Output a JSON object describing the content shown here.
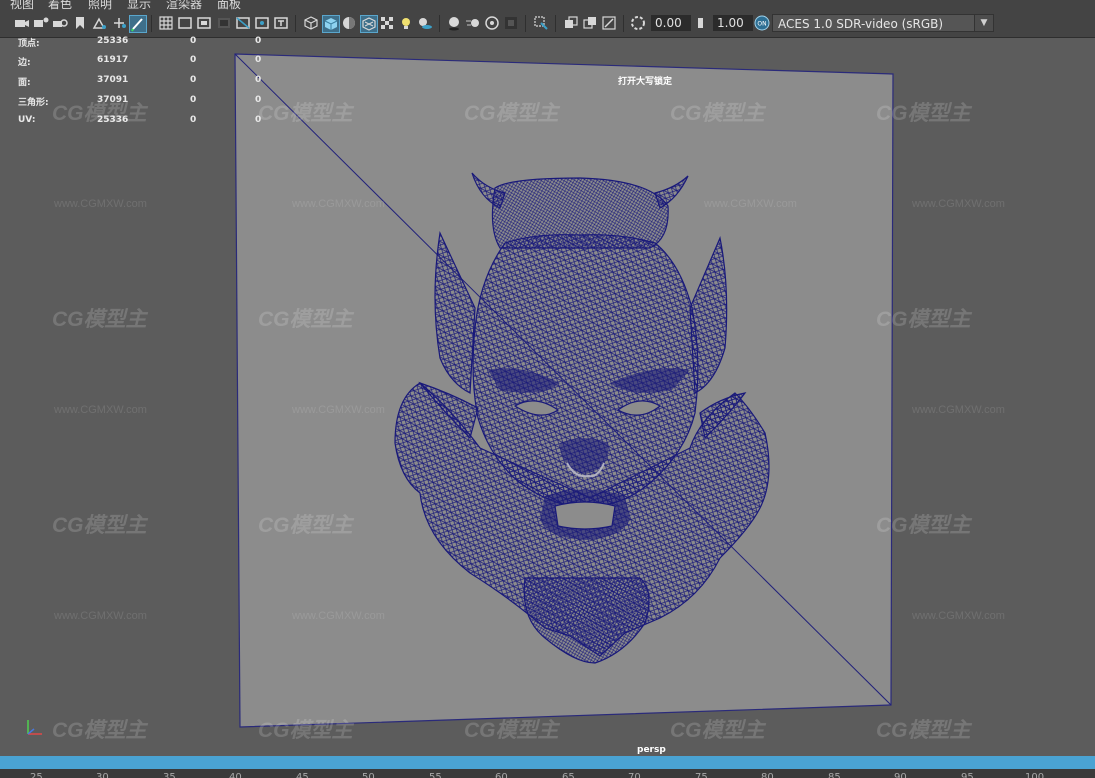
{
  "menu": [
    "视图",
    "着色",
    "照明",
    "显示",
    "渲染器",
    "面板"
  ],
  "toolbar": {
    "camera_near": "0.00",
    "camera_far": "1.00",
    "color_space": "ACES 1.0 SDR-video (sRGB)",
    "icons": [
      "camera-icon",
      "camera-attr-icon",
      "bookmark-icon",
      "image-plane-icon",
      "grid-icon",
      "film-gate-icon",
      "resolution-gate-icon",
      "gate-mask-icon",
      "field-chart-icon",
      "safe-action-icon",
      "safe-title-icon",
      "wireframe-icon",
      "smooth-shade-icon",
      "default-material-icon",
      "textured-icon",
      "lights-icon",
      "shadows-icon",
      "ambient-occlusion-icon",
      "motion-blur-icon",
      "anti-aliasing-icon",
      "depth-of-field-icon",
      "isolate-select-icon",
      "xray-icon",
      "xray-active-icon",
      "xray-joints-icon",
      "exposure-icon",
      "gamma-icon",
      "color-management-icon"
    ]
  },
  "heads_up": {
    "rows": [
      {
        "label": "顶点:",
        "total": "25336",
        "selected": "0",
        "uv_selected": "0"
      },
      {
        "label": "边:",
        "total": "61917",
        "selected": "0",
        "uv_selected": "0"
      },
      {
        "label": "面:",
        "total": "37091",
        "selected": "0",
        "uv_selected": "0"
      },
      {
        "label": "三角形:",
        "total": "37091",
        "selected": "0",
        "uv_selected": "0"
      },
      {
        "label": "UV:",
        "total": "25336",
        "selected": "0",
        "uv_selected": "0"
      }
    ]
  },
  "caps_lock_message": "打开大写锁定",
  "camera_name": "persp",
  "timeline_ticks": [
    "25",
    "30",
    "35",
    "40",
    "45",
    "50",
    "55",
    "60",
    "65",
    "70",
    "75",
    "80",
    "85",
    "90",
    "95",
    "100"
  ],
  "watermark": {
    "logo": "CG模型主",
    "url": "www.CGMXW.com"
  },
  "colors": {
    "wire": "#19197a",
    "plane": "#8c8c8c",
    "viewport_bg": "#5c5c5c",
    "timeline_accent": "#4aa3d3",
    "active_icon": "#3ca0c8"
  }
}
